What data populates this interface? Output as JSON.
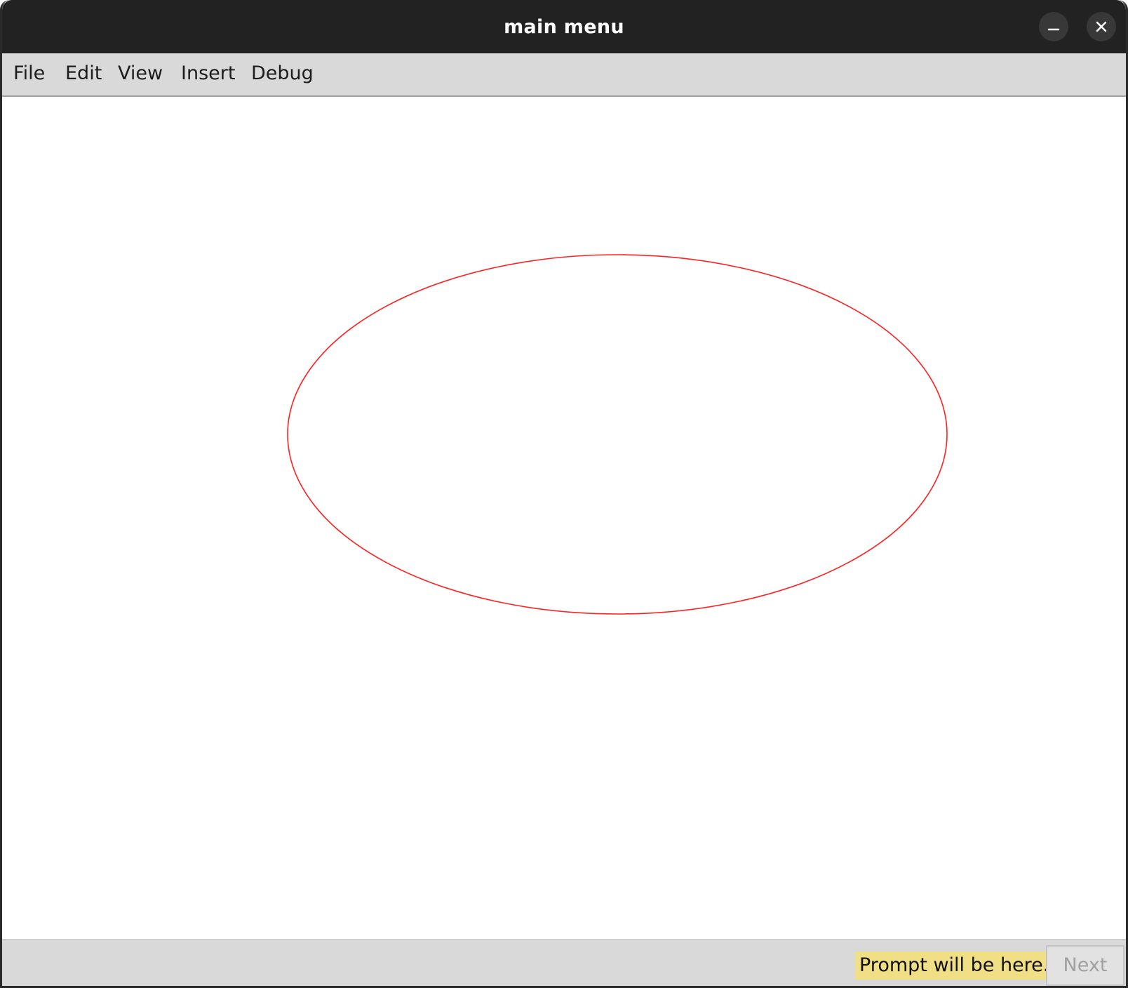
{
  "window": {
    "title": "main menu"
  },
  "titlebar_buttons": {
    "minimize_icon": "minimize-icon",
    "close_icon": "close-icon"
  },
  "menubar": {
    "items": [
      {
        "label": "File"
      },
      {
        "label": "Edit"
      },
      {
        "label": "View"
      },
      {
        "label": "Insert"
      },
      {
        "label": "Debug"
      }
    ]
  },
  "canvas": {
    "shapes": [
      {
        "type": "ellipse",
        "stroke": "#ff2020",
        "fill": "none"
      }
    ]
  },
  "statusbar": {
    "prompt": "Prompt will be here.",
    "prompt_bg": "#f0df85",
    "next_label": "Next",
    "next_enabled": false
  }
}
